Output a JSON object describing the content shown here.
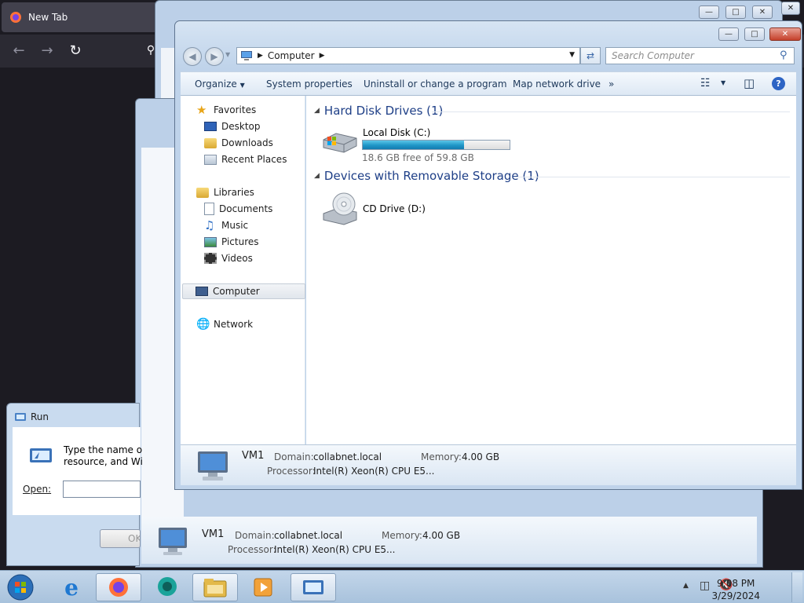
{
  "firefox": {
    "tab_title": "New Tab",
    "back_icon": "arrow-left-icon",
    "forward_icon": "arrow-right-icon",
    "reload_icon": "reload-icon"
  },
  "run_dialog": {
    "title": "Run",
    "text_line1": "Type the name of",
    "text_line2": "resource, and Win",
    "open_label": "Open:",
    "open_value": "",
    "ok_label": "OK"
  },
  "background_window": {
    "computer_name": "VM1",
    "domain_label": "Domain:",
    "domain_value": "collabnet.local",
    "memory_label": "Memory:",
    "memory_value": "4.00 GB",
    "processor_label": "Processor:",
    "processor_value": "Intel(R) Xeon(R) CPU E5..."
  },
  "explorer": {
    "address_path": "Computer",
    "search_placeholder": "Search Computer",
    "commands": {
      "organize": "Organize",
      "system_properties": "System properties",
      "uninstall": "Uninstall or change a program",
      "map_drive": "Map network drive",
      "more": "»"
    },
    "nav": {
      "favorites": "Favorites",
      "desktop": "Desktop",
      "downloads": "Downloads",
      "recent_places": "Recent Places",
      "libraries": "Libraries",
      "documents": "Documents",
      "music": "Music",
      "pictures": "Pictures",
      "videos": "Videos",
      "computer": "Computer",
      "network": "Network"
    },
    "groups": {
      "hard_disk": "Hard Disk Drives (1)",
      "removable": "Devices with Removable Storage (1)"
    },
    "local_disk": {
      "name": "Local Disk (C:)",
      "free_text": "18.6 GB free of 59.8 GB",
      "used_fraction": 0.689
    },
    "cd_drive": {
      "name": "CD Drive (D:)"
    },
    "details": {
      "computer_name": "VM1",
      "domain_label": "Domain:",
      "domain_value": "collabnet.local",
      "memory_label": "Memory:",
      "memory_value": "4.00 GB",
      "processor_label": "Processor:",
      "processor_value": "Intel(R) Xeon(R) CPU E5..."
    }
  },
  "taskbar": {
    "time": "9:08 PM",
    "date": "3/29/2024"
  },
  "colors": {
    "accent_blue": "#1e3f87",
    "drive_fill": "#1f96c7",
    "taskbar": "#b5cce3"
  }
}
